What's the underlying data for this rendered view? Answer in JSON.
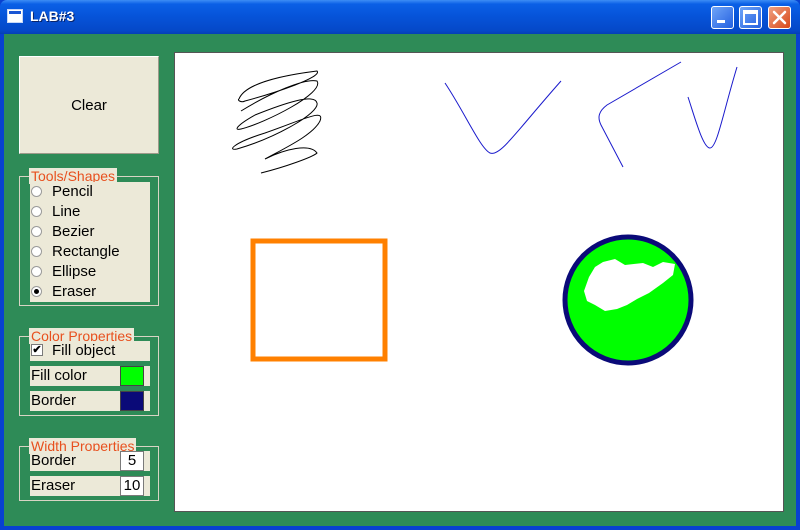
{
  "window": {
    "title": "LAB#3"
  },
  "titlebar_buttons": [
    "minimize",
    "maximize",
    "close"
  ],
  "toolbar": {
    "clear_label": "Clear"
  },
  "tools": {
    "title": "Tools/Shapes",
    "options": [
      {
        "label": "Pencil",
        "checked": false
      },
      {
        "label": "Line",
        "checked": false
      },
      {
        "label": "Bezier",
        "checked": false
      },
      {
        "label": "Rectangle",
        "checked": false
      },
      {
        "label": "Ellipse",
        "checked": false
      },
      {
        "label": "Eraser",
        "checked": true
      }
    ]
  },
  "color_props": {
    "title": "Color Properties",
    "fill_object_label": "Fill object",
    "fill_object_checked": true,
    "fill_color_label": "Fill color",
    "fill_color": "#00ff00",
    "border_label": "Border",
    "border_color": "#0a0a78"
  },
  "width_props": {
    "title": "Width Properties",
    "border_label": "Border",
    "border_value": "5",
    "eraser_label": "Eraser",
    "eraser_value": "10"
  },
  "colors": {
    "client_bg": "#2e8b57",
    "accent_title": "#e8501e",
    "rect_border": "#ff8000",
    "line_color": "#1a1acc"
  }
}
